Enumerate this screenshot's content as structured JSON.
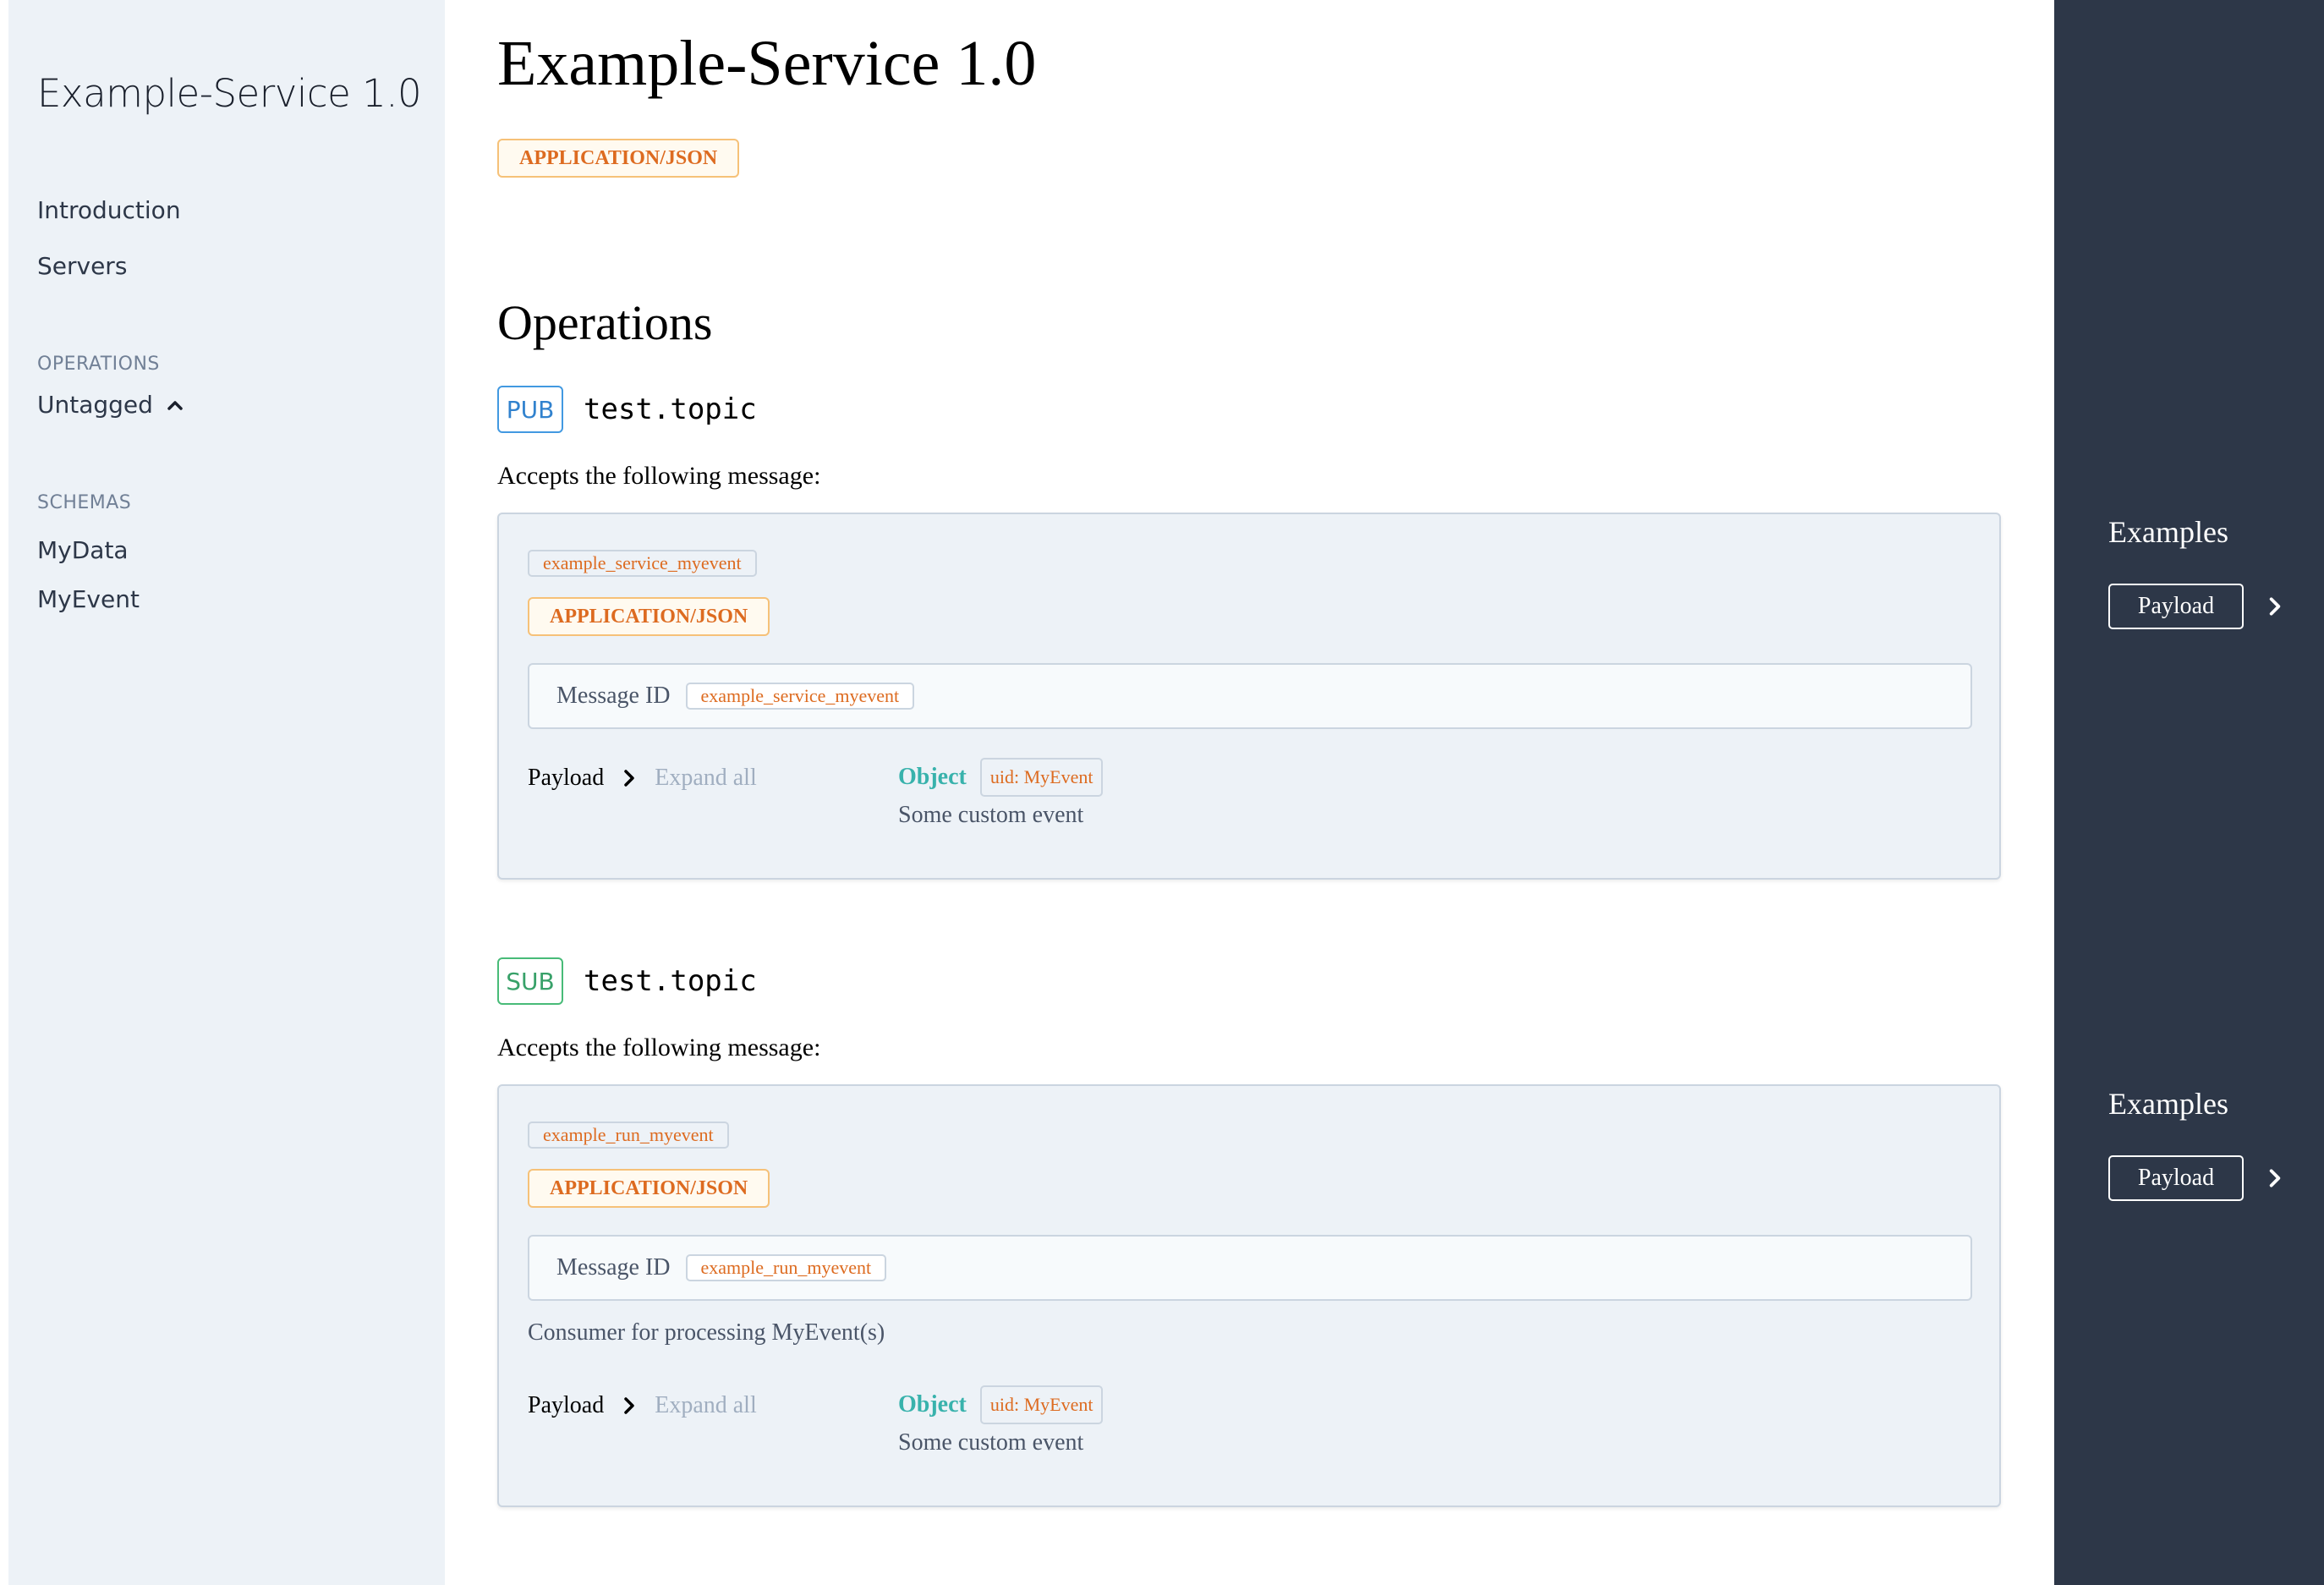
{
  "sidebar": {
    "title": "Example-Service 1.0",
    "nav": [
      {
        "label": "Introduction"
      },
      {
        "label": "Servers"
      }
    ],
    "operations_heading": "OPERATIONS",
    "operations_group": "Untagged",
    "schemas_heading": "SCHEMAS",
    "schemas": [
      {
        "label": "MyData"
      },
      {
        "label": "MyEvent"
      }
    ]
  },
  "main": {
    "title": "Example-Service 1.0",
    "default_content_type": "APPLICATION/JSON",
    "operations_heading": "Operations",
    "operations": [
      {
        "kind": "PUB",
        "channel": "test.topic",
        "accepts_text": "Accepts the following message:",
        "message": {
          "name": "example_service_myevent",
          "content_type": "APPLICATION/JSON",
          "message_id_label": "Message ID",
          "message_id": "example_service_myevent",
          "description": "",
          "payload_label": "Payload",
          "expand_all_label": "Expand all",
          "schema_type": "Object",
          "schema_uid": "uid: MyEvent",
          "schema_description": "Some custom event"
        }
      },
      {
        "kind": "SUB",
        "channel": "test.topic",
        "accepts_text": "Accepts the following message:",
        "message": {
          "name": "example_run_myevent",
          "content_type": "APPLICATION/JSON",
          "message_id_label": "Message ID",
          "message_id": "example_run_myevent",
          "description": "Consumer for processing MyEvent(s)",
          "payload_label": "Payload",
          "expand_all_label": "Expand all",
          "schema_type": "Object",
          "schema_uid": "uid: MyEvent",
          "schema_description": "Some custom event"
        }
      }
    ]
  },
  "examples_panel": [
    {
      "title": "Examples",
      "button_label": "Payload"
    },
    {
      "title": "Examples",
      "button_label": "Payload"
    }
  ],
  "colors": {
    "sidebar_bg": "#edf2f7",
    "right_panel_bg": "#2d3748",
    "pub_blue": "#3182ce",
    "sub_green": "#38a169",
    "content_type_orange": "#dd6b20",
    "object_teal": "#38b2ac"
  },
  "icons": {
    "operations_toggle": "chevron-up-icon",
    "payload_toggle": "chevron-right-icon",
    "example_toggle": "chevron-right-icon"
  }
}
